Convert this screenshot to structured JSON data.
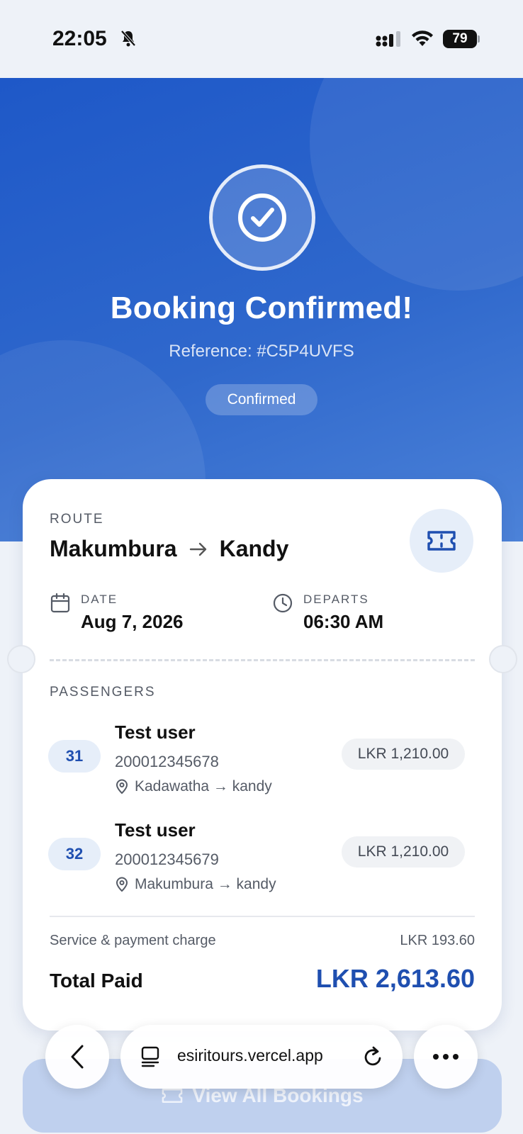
{
  "status_bar": {
    "time": "22:05",
    "battery": "79",
    "icons": [
      "bell-slash-icon",
      "signal-icon",
      "wifi-icon",
      "battery-icon"
    ]
  },
  "hero": {
    "icon": "check-circle-icon",
    "title": "Booking Confirmed!",
    "reference": "Reference: #C5P4UVFS",
    "status_badge": "Confirmed"
  },
  "card": {
    "route_label": "ROUTE",
    "route_from": "Makumbura",
    "route_to": "Kandy",
    "route_icon": "ticket-icon",
    "date_label": "DATE",
    "date_value": "Aug 7, 2026",
    "departs_label": "DEPARTS",
    "departs_value": "06:30 AM",
    "passengers_label": "PASSENGERS",
    "passengers": [
      {
        "seat": "31",
        "name": "Test user",
        "nic": "200012345678",
        "route": "Kadawatha → kandy",
        "price": "LKR 1,210.00"
      },
      {
        "seat": "32",
        "name": "Test user",
        "nic": "200012345679",
        "route": "Makumbura → kandy",
        "price": "LKR 1,210.00"
      }
    ],
    "service_label": "Service & payment charge",
    "service_value": "LKR 193.60",
    "total_label": "Total Paid",
    "total_value": "LKR 2,613.60"
  },
  "bottom_button": {
    "label": "View All Bookings"
  },
  "browser": {
    "url": "esiritours.vercel.app"
  },
  "colors": {
    "primary": "#1F4FB0",
    "hero_start": "#1E58C8",
    "hero_end": "#4C82D8",
    "background": "#EEF2F8"
  }
}
